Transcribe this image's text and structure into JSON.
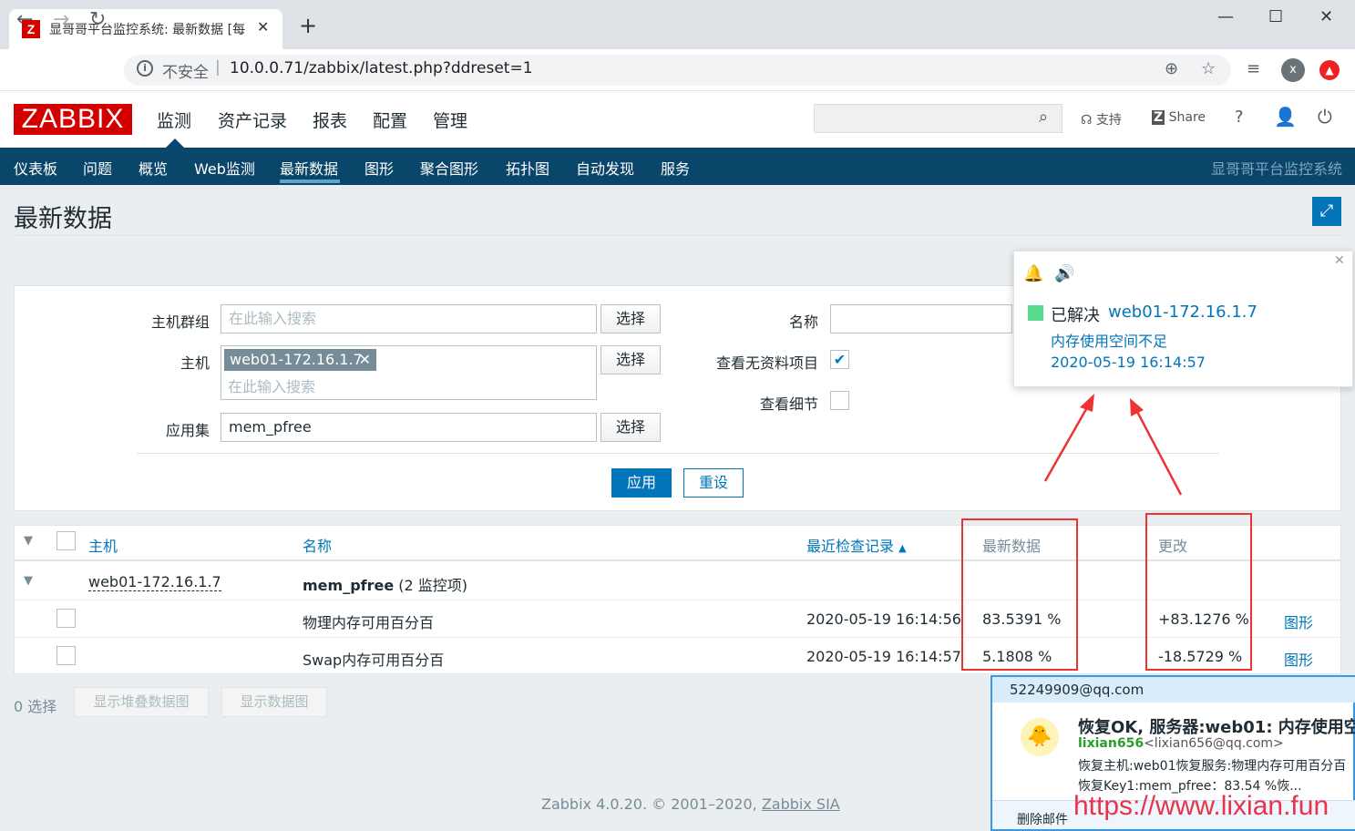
{
  "browser": {
    "tab_title": "显哥哥平台监控系统: 最新数据 [每",
    "favicon": "Z",
    "insecure_label": "不安全",
    "url": "10.0.0.71/zabbix/latest.php?ddreset=1",
    "avatar_letter": "x"
  },
  "header": {
    "logo": "ZABBIX",
    "menu": [
      "监测",
      "资产记录",
      "报表",
      "配置",
      "管理"
    ],
    "support": "支持",
    "share": "Share",
    "help": "?"
  },
  "subnav": {
    "items": [
      "仪表板",
      "问题",
      "概览",
      "Web监测",
      "最新数据",
      "图形",
      "聚合图形",
      "拓扑图",
      "自动发现",
      "服务"
    ],
    "active": "最新数据",
    "system_name": "显哥哥平台监控系统"
  },
  "page": {
    "title": "最新数据"
  },
  "filter": {
    "host_group_label": "主机群组",
    "host_group_placeholder": "在此输入搜索",
    "host_label": "主机",
    "host_tag": "web01-172.16.1.7",
    "host_placeholder": "在此输入搜索",
    "app_label": "应用集",
    "app_value": "mem_pfree",
    "select_label": "选择",
    "name_label": "名称",
    "name_value": "",
    "show_no_data_label": "查看无资料项目",
    "show_no_data_checked": true,
    "show_details_label": "查看细节",
    "show_details_checked": false,
    "apply": "应用",
    "reset": "重设"
  },
  "table": {
    "headers": {
      "host": "主机",
      "name": "名称",
      "last_check": "最近检查记录",
      "last_value": "最新数据",
      "change": "更改"
    },
    "group": {
      "host": "web01-172.16.1.7",
      "app": "mem_pfree",
      "count": "(2 监控项)"
    },
    "rows": [
      {
        "name": "物理内存可用百分百",
        "last_check": "2020-05-19 16:14:56",
        "last_value": "83.5391 %",
        "change": "+83.1276 %",
        "graph": "图形"
      },
      {
        "name": "Swap内存可用百分百",
        "last_check": "2020-05-19 16:14:57",
        "last_value": "5.1808 %",
        "change": "-18.5729 %",
        "graph": "图形"
      }
    ]
  },
  "bottom": {
    "selected": "0 选择",
    "stacked_graph": "显示堆叠数据图",
    "graph": "显示数据图",
    "footer_prefix": "Zabbix 4.0.20. © 2001–2020,",
    "footer_link": "Zabbix SIA"
  },
  "notification": {
    "status": "已解决",
    "host": "web01-172.16.1.7",
    "problem": "内存使用空间不足",
    "time": "2020-05-19 16:14:57"
  },
  "mail": {
    "account": "52249909@qq.com",
    "subject": "恢复OK, 服务器:web01: 内存使用空...",
    "from_name": "lixian656",
    "from_addr": "<lixian656@qq.com>",
    "line1": "恢复主机:web01恢复服务:物理内存可用百分百",
    "line2": "恢复Key1:mem_pfree：83.54 %恢...",
    "delete": "删除邮件"
  },
  "watermark": "https://www.lixian.fun",
  "colors": {
    "zabbix_red": "#d40000",
    "nav_blue": "#0a466a",
    "link_blue": "#0275b8",
    "annotation_red": "#e33"
  }
}
